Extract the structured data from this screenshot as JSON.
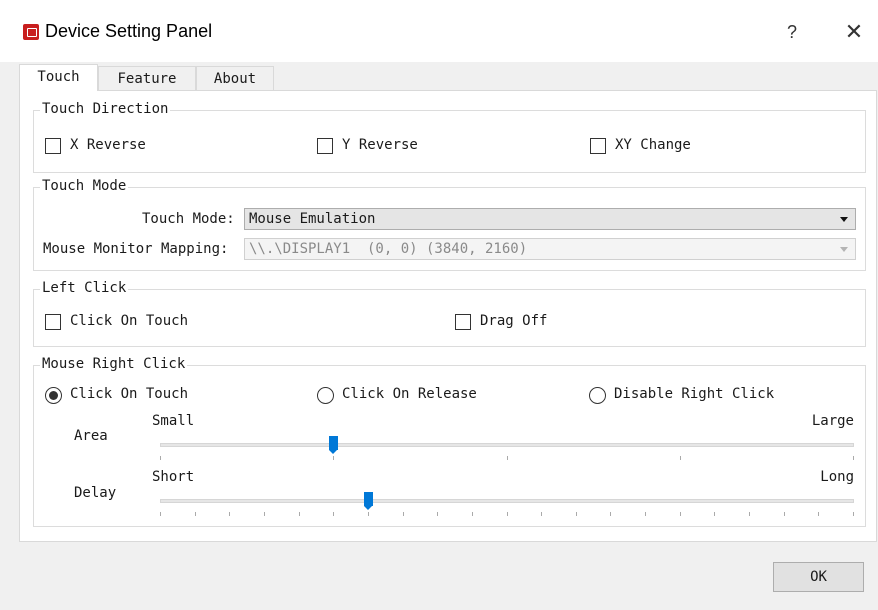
{
  "window": {
    "title": "Device Setting Panel",
    "help": "?",
    "close": "✕"
  },
  "tabs": [
    "Touch",
    "Feature",
    "About"
  ],
  "touch_direction": {
    "legend": "Touch Direction",
    "options": [
      {
        "label": "X Reverse",
        "checked": false
      },
      {
        "label": "Y Reverse",
        "checked": false
      },
      {
        "label": "XY Change",
        "checked": false
      }
    ]
  },
  "touch_mode": {
    "legend": "Touch Mode",
    "mode_label": "Touch Mode:",
    "mode_value": "Mouse Emulation",
    "mapping_label": "Mouse Monitor Mapping:",
    "mapping_value": "\\\\.\\DISPLAY1  (0, 0) (3840, 2160)"
  },
  "left_click": {
    "legend": "Left Click",
    "options": [
      {
        "label": "Click On Touch",
        "checked": false
      },
      {
        "label": "Drag Off",
        "checked": false
      }
    ]
  },
  "right_click": {
    "legend": "Mouse Right Click",
    "options": [
      {
        "label": "Click On Touch",
        "selected": true
      },
      {
        "label": "Click On Release",
        "selected": false
      },
      {
        "label": "Disable Right Click",
        "selected": false
      }
    ],
    "area": {
      "label": "Area",
      "min_label": "Small",
      "max_label": "Large",
      "position": 0.25,
      "ticks": 5
    },
    "delay": {
      "label": "Delay",
      "min_label": "Short",
      "max_label": "Long",
      "position": 0.3,
      "ticks": 21
    }
  },
  "footer": {
    "ok": "OK"
  },
  "colors": {
    "accent": "#0078d7",
    "app_icon": "#c81e1e"
  }
}
